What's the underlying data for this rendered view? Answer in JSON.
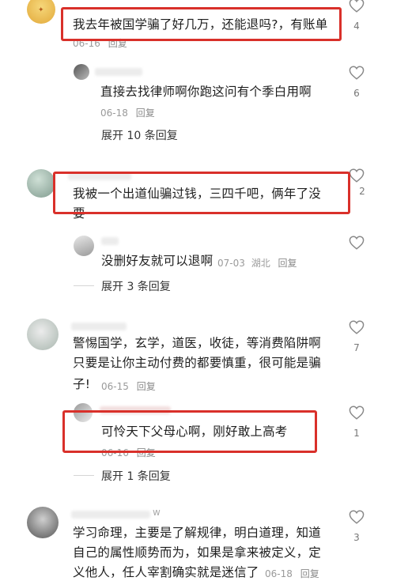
{
  "comments": [
    {
      "text": "我去年被国学骗了好几万，还能退吗?，有账单",
      "meta_date": "06-16",
      "reply_label": "回复",
      "likes": "4",
      "replies": [
        {
          "text": "直接去找律师啊你跑这问有个季白用啊",
          "meta_date": "06-18",
          "reply_label": "回复",
          "likes": "6"
        }
      ],
      "expand_label": "展开 10 条回复"
    },
    {
      "text_line1": "我被一个出道仙骗过钱，三四千吧，俩年了没",
      "text_line2": "要",
      "likes": "2",
      "replies": [
        {
          "text": "没删好友就可以退啊",
          "meta_date": "07-03",
          "meta_location": "湖北",
          "reply_label": "回复",
          "likes": ""
        }
      ],
      "expand_label": "展开 3 条回复"
    },
    {
      "text_line1": "警惕国学，玄学，道医，收徒，等消费陷阱啊",
      "text_line2": "只要是让你主动付费的都要慎重，很可能是骗",
      "text_line3": "子!",
      "meta_date": "06-15",
      "reply_label": "回复",
      "likes": "7",
      "replies": [
        {
          "text": "可怜天下父母心啊，刚好敢上高考",
          "meta_date": "06-16",
          "reply_label": "回复",
          "likes": "1"
        }
      ],
      "expand_label": "展开 1 条回复"
    },
    {
      "text_line1": "学习命理，主要是了解规律，明白道理，知道",
      "text_line2": "自己的属性顺势而为，如果是拿来被定义，定",
      "text_line3": "义他人，任人宰割确实就是迷信了",
      "meta_date": "06-18",
      "reply_label": "回复",
      "likes": "3",
      "name_tail": "w"
    }
  ],
  "colors": {
    "highlight_box": "#d9302a",
    "meta_text": "#9a9a9a",
    "body_text": "#1e1e1e"
  },
  "icons": {
    "like": "heart-outline-icon"
  }
}
